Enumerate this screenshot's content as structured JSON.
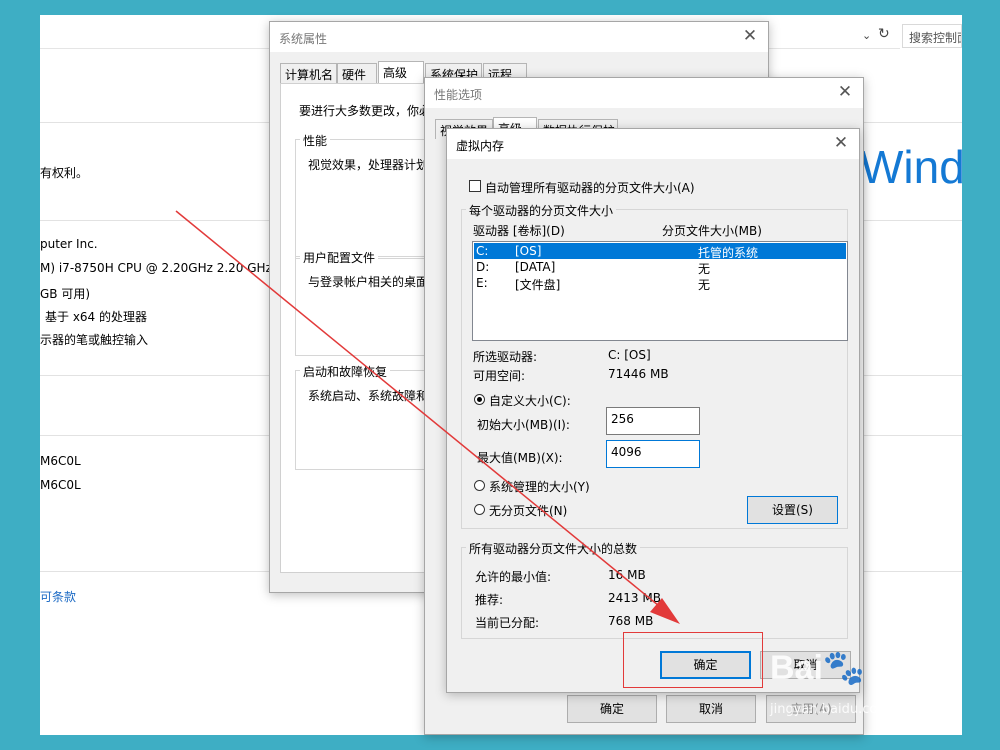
{
  "background": {
    "search_placeholder": "搜索控制面",
    "rights_text": "有权利。",
    "manufacturer_text": "puter Inc.",
    "cpu_text": "M) i7-8750H CPU @ 2.20GHz   2.20 GHz",
    "ram_text": "GB 可用)",
    "systype_text": "基于 x64 的处理器",
    "pen_text": "示器的笔或触控输入",
    "id1": "M6C0L",
    "id2": "M6C0L",
    "license_link": "可条款",
    "logo_text": "Wind"
  },
  "sysprops": {
    "title": "系统属性",
    "tabs": [
      "计算机名",
      "硬件",
      "高级",
      "系统保护",
      "远程"
    ],
    "intro": "要进行大多数更改，你必",
    "perf_group": "性能",
    "perf_desc": "视觉效果，处理器计划",
    "profile_group": "用户配置文件",
    "profile_desc": "与登录帐户相关的桌面",
    "startup_group": "启动和故障恢复",
    "startup_desc": "系统启动、系统故障和"
  },
  "perfopts": {
    "title": "性能选项",
    "tabs": [
      "视觉效果",
      "高级",
      "数据执行保护"
    ],
    "ok_label": "确定",
    "cancel_label": "取消",
    "apply_label": "应用(A)"
  },
  "vmem": {
    "title": "虚拟内存",
    "auto_manage_label": "自动管理所有驱动器的分页文件大小(A)",
    "per_drive_group": "每个驱动器的分页文件大小",
    "col_drive": "驱动器 [卷标](D)",
    "col_size": "分页文件大小(MB)",
    "drives": [
      {
        "letter": "C:",
        "label": "[OS]",
        "size": "托管的系统"
      },
      {
        "letter": "D:",
        "label": "[DATA]",
        "size": "无"
      },
      {
        "letter": "E:",
        "label": "[文件盘]",
        "size": "无"
      }
    ],
    "selected_drive_label": "所选驱动器:",
    "selected_drive_value": "C:  [OS]",
    "free_space_label": "可用空间:",
    "free_space_value": "71446 MB",
    "custom_size_label": "自定义大小(C):",
    "initial_size_label": "初始大小(MB)(I):",
    "initial_size_value": "256",
    "max_size_label": "最大值(MB)(X):",
    "max_size_value": "4096",
    "system_managed_label": "系统管理的大小(Y)",
    "no_paging_label": "无分页文件(N)",
    "set_button": "设置(S)",
    "total_group": "所有驱动器分页文件大小的总数",
    "min_allowed_label": "允许的最小值:",
    "min_allowed_value": "16 MB",
    "recommended_label": "推荐:",
    "recommended_value": "2413 MB",
    "allocated_label": "当前已分配:",
    "allocated_value": "768 MB",
    "ok_label": "确定",
    "cancel_label": "取消"
  },
  "watermark": {
    "main": "Bai🐾 经验",
    "sub": "jingyan.baidu.com"
  },
  "colors": {
    "background": "#3eaec4",
    "accent": "#0078d7",
    "annotation": "#e23a3a"
  }
}
